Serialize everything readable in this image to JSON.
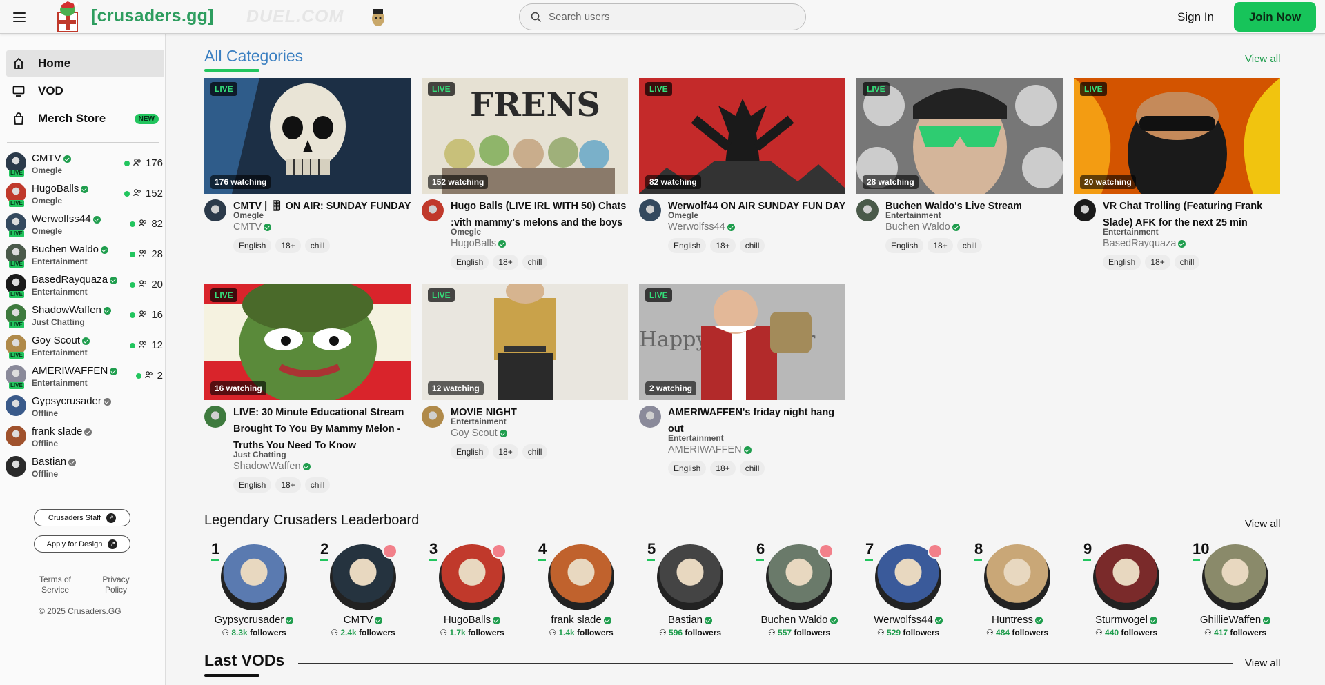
{
  "header": {
    "logo_text": "[crusaders.gg]",
    "banner_text": "DUEL.COM",
    "search_placeholder": "Search users",
    "sign_in": "Sign In",
    "join_now": "Join Now"
  },
  "sidebar": {
    "nav": [
      {
        "label": "Home",
        "icon": "home-icon"
      },
      {
        "label": "VOD",
        "icon": "monitor-icon"
      },
      {
        "label": "Merch Store",
        "icon": "shopping-bag-icon",
        "badge": "NEW"
      }
    ],
    "channels": [
      {
        "name": "CMTV",
        "category": "Omegle",
        "viewers": "176",
        "live": true,
        "color": "#2b3a4a"
      },
      {
        "name": "HugoBalls",
        "category": "Omegle",
        "viewers": "152",
        "live": true,
        "color": "#c0392b"
      },
      {
        "name": "Werwolfss44",
        "category": "Omegle",
        "viewers": "82",
        "live": true,
        "color": "#34495e"
      },
      {
        "name": "Buchen Waldo",
        "category": "Entertainment",
        "viewers": "28",
        "live": true,
        "color": "#4a5a4a"
      },
      {
        "name": "BasedRayquaza",
        "category": "Entertainment",
        "viewers": "20",
        "live": true,
        "color": "#1a1a1a"
      },
      {
        "name": "ShadowWaffen",
        "category": "Just Chatting",
        "viewers": "16",
        "live": true,
        "color": "#3e7a3e"
      },
      {
        "name": "Goy Scout",
        "category": "Entertainment",
        "viewers": "12",
        "live": true,
        "color": "#b08a4a"
      },
      {
        "name": "AMERIWAFFEN",
        "category": "Entertainment",
        "viewers": "2",
        "live": true,
        "color": "#8a8a9a"
      },
      {
        "name": "Gypsycrusader",
        "category": "Offline",
        "viewers": "",
        "live": false,
        "color": "#3a5a8a"
      },
      {
        "name": "frank slade",
        "category": "Offline",
        "viewers": "",
        "live": false,
        "color": "#a0522d"
      },
      {
        "name": "Bastian",
        "category": "Offline",
        "viewers": "",
        "live": false,
        "color": "#2a2a2a"
      }
    ],
    "staff_button": "Crusaders Staff",
    "design_button": "Apply for Design",
    "terms": "Terms of Service",
    "privacy": "Privacy Policy",
    "copyright": "© 2025 Crusaders.GG"
  },
  "categories": {
    "title": "All Categories",
    "view_all": "View all",
    "live_label": "LIVE",
    "streams": [
      {
        "title": "CMTV | 🎚 ON AIR: SUNDAY FUNDAY",
        "category": "Omegle",
        "user": "CMTV",
        "watching": "176 watching",
        "tags": [
          "English",
          "18+",
          "chill"
        ]
      },
      {
        "title": "Hugo Balls (LIVE IRL WITH 50) Chats :vith mammy's melons and the boys",
        "category": "Omegle",
        "user": "HugoBalls",
        "watching": "152 watching",
        "tags": [
          "English",
          "18+",
          "chill"
        ]
      },
      {
        "title": "Werwolf44 ON AIR SUNDAY FUN DAY",
        "category": "Omegle",
        "user": "Werwolfss44",
        "watching": "82 watching",
        "tags": [
          "English",
          "18+",
          "chill"
        ]
      },
      {
        "title": "Buchen Waldo's Live Stream",
        "category": "Entertainment",
        "user": "Buchen Waldo",
        "watching": "28 watching",
        "tags": [
          "English",
          "18+",
          "chill"
        ]
      },
      {
        "title": "VR Chat Trolling (Featuring Frank Slade) AFK for the next 25 min",
        "category": "Entertainment",
        "user": "BasedRayquaza",
        "watching": "20 watching",
        "tags": [
          "English",
          "18+",
          "chill"
        ]
      },
      {
        "title": "LIVE: 30 Minute Educational Stream Brought To You By Mammy Melon - Truths You Need To Know",
        "category": "Just Chatting",
        "user": "ShadowWaffen",
        "watching": "16 watching",
        "tags": [
          "English",
          "18+",
          "chill"
        ]
      },
      {
        "title": "MOVIE NIGHT",
        "category": "Entertainment",
        "user": "Goy Scout",
        "watching": "12 watching",
        "tags": [
          "English",
          "18+",
          "chill"
        ]
      },
      {
        "title": "AMERIWAFFEN's friday night hang out",
        "category": "Entertainment",
        "user": "AMERIWAFFEN",
        "watching": "2 watching",
        "tags": [
          "English",
          "18+",
          "chill"
        ]
      }
    ]
  },
  "leaderboard": {
    "title": "Legendary Crusaders Leaderboard",
    "view_all": "View all",
    "followers_label": "followers",
    "entries": [
      {
        "rank": "1",
        "name": "Gypsycrusader",
        "followers": "8.3k",
        "live": false,
        "color": "#5a7ab0"
      },
      {
        "rank": "2",
        "name": "CMTV",
        "followers": "2.4k",
        "live": true,
        "color": "#25333f"
      },
      {
        "rank": "3",
        "name": "HugoBalls",
        "followers": "1.7k",
        "live": true,
        "color": "#c0392b"
      },
      {
        "rank": "4",
        "name": "frank slade",
        "followers": "1.4k",
        "live": false,
        "color": "#c0622d"
      },
      {
        "rank": "5",
        "name": "Bastian",
        "followers": "596",
        "live": false,
        "color": "#444444"
      },
      {
        "rank": "6",
        "name": "Buchen Waldo",
        "followers": "557",
        "live": true,
        "color": "#6a7a6a"
      },
      {
        "rank": "7",
        "name": "Werwolfss44",
        "followers": "529",
        "live": true,
        "color": "#3a5a9a"
      },
      {
        "rank": "8",
        "name": "Huntress",
        "followers": "484",
        "live": false,
        "color": "#c9a777"
      },
      {
        "rank": "9",
        "name": "Sturmvogel",
        "followers": "440",
        "live": false,
        "color": "#7a2a2a"
      },
      {
        "rank": "10",
        "name": "GhillieWaffen",
        "followers": "417",
        "live": false,
        "color": "#8a8a6a"
      }
    ]
  },
  "vods": {
    "title": "Last VODs",
    "view_all": "View all"
  },
  "colors": {
    "accent_green": "#22c55e",
    "brand_green": "#2e9d5f",
    "join_button": "#17c45a",
    "category_title_blue": "#3a7fc1",
    "view_all_green": "#1f9d4d"
  }
}
